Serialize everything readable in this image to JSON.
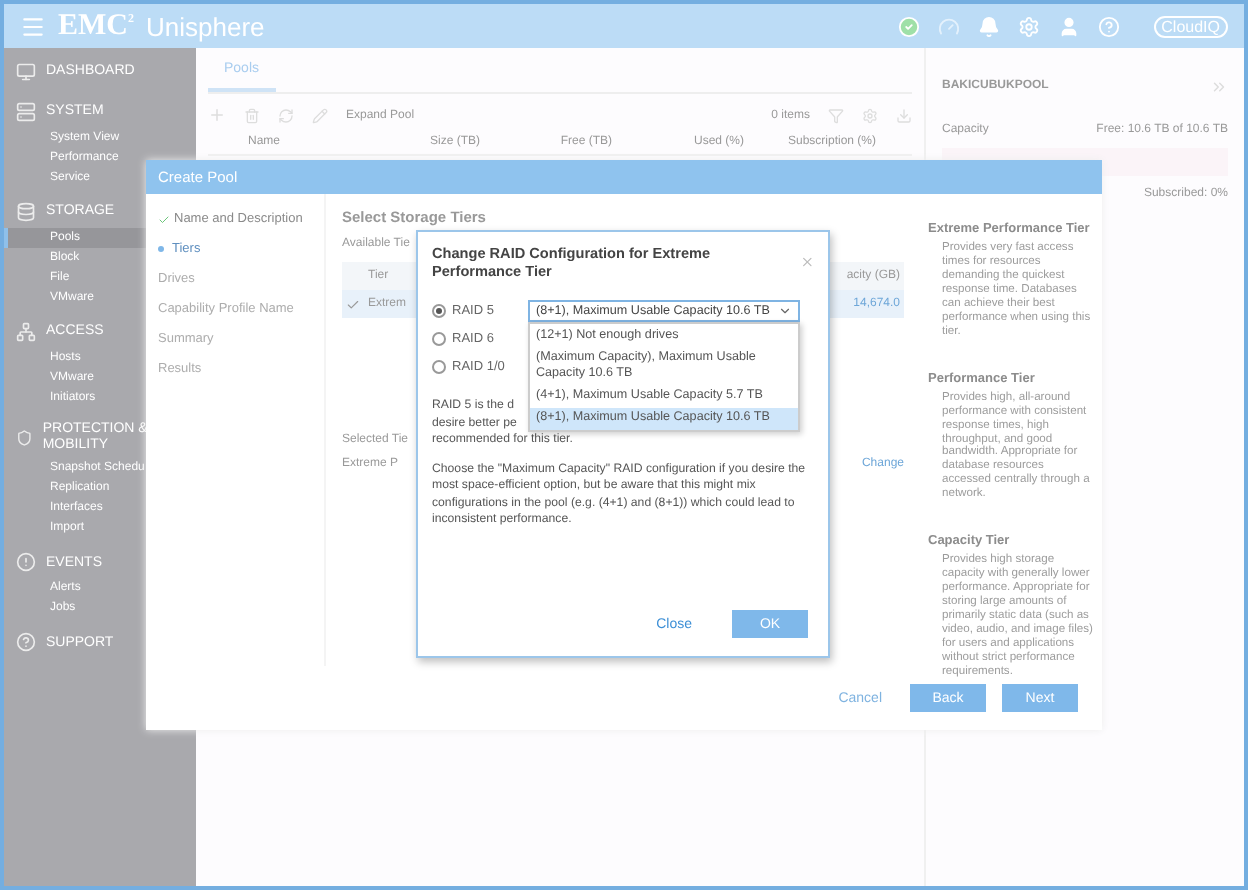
{
  "header": {
    "brand": "EMC",
    "brand_sup": "2",
    "product": "Unisphere",
    "logo": "CloudIQ"
  },
  "sidebar": [
    {
      "label": "DASHBOARD",
      "kind": "dashboard"
    },
    {
      "label": "SYSTEM",
      "kind": "system",
      "items": [
        {
          "label": "System View",
          "selected": false
        },
        {
          "label": "Performance",
          "selected": false
        },
        {
          "label": "Service",
          "selected": false
        }
      ]
    },
    {
      "label": "STORAGE",
      "kind": "storage",
      "items": [
        {
          "label": "Pools",
          "selected": true
        },
        {
          "label": "Block",
          "selected": false
        },
        {
          "label": "File",
          "selected": false
        },
        {
          "label": "VMware",
          "selected": false
        }
      ]
    },
    {
      "label": "ACCESS",
      "kind": "access",
      "items": [
        {
          "label": "Hosts",
          "selected": false
        },
        {
          "label": "VMware",
          "selected": false
        },
        {
          "label": "Initiators",
          "selected": false
        }
      ]
    },
    {
      "label": "PROTECTION & MOBILITY",
      "kind": "protection",
      "items": [
        {
          "label": "Snapshot Schedu",
          "selected": false
        },
        {
          "label": "Replication",
          "selected": false
        },
        {
          "label": "Interfaces",
          "selected": false
        },
        {
          "label": "Import",
          "selected": false
        }
      ]
    },
    {
      "label": "EVENTS",
      "kind": "events",
      "items": [
        {
          "label": "Alerts",
          "selected": false
        },
        {
          "label": "Jobs",
          "selected": false
        }
      ]
    },
    {
      "label": "SUPPORT",
      "kind": "support"
    }
  ],
  "main": {
    "tabs": [
      {
        "label": "Pools",
        "selected": true
      }
    ],
    "toolbar_action": "Expand Pool",
    "item_count": "0 items",
    "columns": [
      "Name",
      "Size (TB)",
      "Free (TB)",
      "Used (%)",
      "Subscription (%)"
    ],
    "detail": {
      "title": "BAKICUBUKPOOL",
      "capacity_label": "Capacity",
      "free": "Free: 10.6 TB of 10.6 TB",
      "subscribed": "Subscribed: 0%"
    }
  },
  "create_pool": {
    "title": "Create Pool",
    "steps": [
      {
        "label": "Name and Description",
        "done": true,
        "selected": false
      },
      {
        "label": "Tiers",
        "done": false,
        "selected": true
      },
      {
        "label": "Drives",
        "done": false,
        "selected": false
      },
      {
        "label": "Capability Profile Name",
        "done": false,
        "selected": false
      },
      {
        "label": "Summary",
        "done": false,
        "selected": false
      },
      {
        "label": "Results",
        "done": false,
        "selected": false
      }
    ],
    "heading": "Select Storage Tiers",
    "available_label": "Available Tie",
    "columns": [
      "Tier",
      "acity (GB)"
    ],
    "rows": [
      {
        "tier": "Extrem",
        "capacity": "14,674.0",
        "checked": true
      }
    ],
    "selected_label": "Selected Tie",
    "selected_tier": "Extreme P",
    "change_link": "Change",
    "tiers": [
      {
        "title": "Extreme Performance Tier",
        "text": "Provides very fast access times for resources demanding the quickest response time. Databases can achieve their best performance when using this tier."
      },
      {
        "title": "Performance Tier",
        "text": "Provides high, all-around performance with consistent response times, high throughput, and good bandwidth. Appropriate for database resources accessed centrally through a network."
      },
      {
        "title": "Capacity Tier",
        "text": "Provides high storage capacity with generally lower performance. Appropriate for storing large amounts of primarily static data (such as video, audio, and image files) for users and applications without strict performance requirements."
      }
    ],
    "buttons": [
      {
        "label": "Cancel",
        "kind": "link",
        "disabled": true
      },
      {
        "label": "Back",
        "kind": "primary",
        "disabled": true
      },
      {
        "label": "Next",
        "kind": "primary",
        "disabled": true
      }
    ]
  },
  "raid_dialog": {
    "title": "Change RAID Configuration for Extreme Performance Tier",
    "options": [
      {
        "label": "RAID 5",
        "selected": true
      },
      {
        "label": "RAID 6",
        "selected": false
      },
      {
        "label": "RAID 1/0",
        "selected": false
      }
    ],
    "select_value": "(8+1), Maximum Usable Capacity 10.6 TB",
    "dropdown_open": true,
    "dropdown": [
      {
        "label": "(12+1) Not enough drives",
        "selected": false
      },
      {
        "label": "(Maximum Capacity), Maximum Usable Capacity 10.6 TB",
        "selected": false
      },
      {
        "label": "(4+1), Maximum Usable Capacity 5.7 TB",
        "selected": false
      },
      {
        "label": "(8+1), Maximum Usable Capacity 10.6 TB",
        "selected": true
      }
    ],
    "description_lines": [
      "RAID 5 is the d",
      "desire better pe",
      "recommended for this tier."
    ],
    "note": "Choose the \"Maximum Capacity\" RAID configuration if you desire the most space-efficient option, but be aware that this might mix configurations in the pool (e.g. (4+1) and (8+1)) which could lead to inconsistent performance.",
    "buttons": [
      {
        "label": "Close",
        "kind": "link",
        "disabled": false
      },
      {
        "label": "OK",
        "kind": "primary",
        "disabled": true
      }
    ]
  }
}
